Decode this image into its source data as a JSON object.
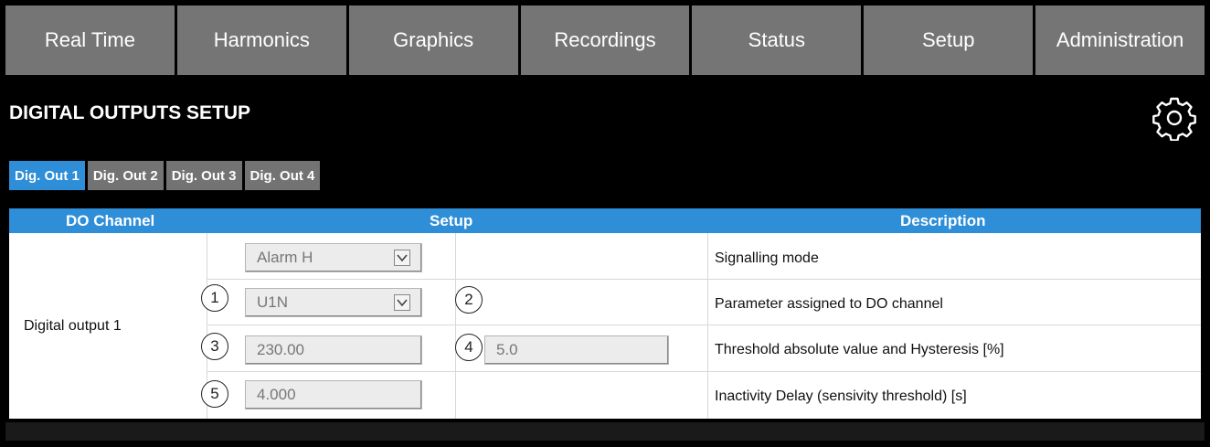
{
  "nav": {
    "items": [
      {
        "label": "Real Time"
      },
      {
        "label": "Harmonics"
      },
      {
        "label": "Graphics"
      },
      {
        "label": "Recordings"
      },
      {
        "label": "Status"
      },
      {
        "label": "Setup"
      },
      {
        "label": "Administration"
      }
    ]
  },
  "page": {
    "title": "DIGITAL OUTPUTS SETUP",
    "settings_icon": "gear-icon"
  },
  "subtabs": {
    "items": [
      {
        "label": "Dig. Out 1",
        "active": true
      },
      {
        "label": "Dig. Out 2",
        "active": false
      },
      {
        "label": "Dig. Out 3",
        "active": false
      },
      {
        "label": "Dig. Out 4",
        "active": false
      }
    ]
  },
  "table": {
    "headers": {
      "channel": "DO Channel",
      "setup": "Setup",
      "description": "Description"
    },
    "channel_label": "Digital output 1",
    "rows": [
      {
        "description": "Signalling mode",
        "field": "Alarm H",
        "field_type": "select"
      },
      {
        "description": "Parameter assigned to DO channel",
        "field": "U1N",
        "field_type": "select",
        "callout": "1",
        "callout2": "2"
      },
      {
        "description": "Threshold absolute value and Hysteresis [%]",
        "field": "230.00",
        "field_type": "text",
        "callout": "3",
        "field2": "5.0",
        "callout2": "4"
      },
      {
        "description": "Inactivity Delay (sensivity threshold) [s]",
        "field": "4.000",
        "field_type": "text",
        "callout": "5"
      }
    ]
  },
  "colors": {
    "accent": "#2e8ed8",
    "nav_bg": "#757575",
    "background": "#000000"
  }
}
